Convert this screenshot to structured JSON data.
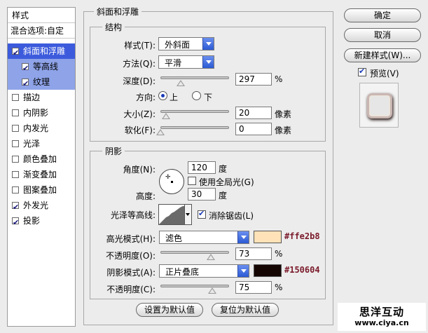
{
  "sidebar": {
    "title": "样式",
    "blending": "混合选项:自定",
    "items": [
      {
        "label": "斜面和浮雕",
        "checked": true
      },
      {
        "label": "等高线",
        "checked": true
      },
      {
        "label": "纹理",
        "checked": true
      },
      {
        "label": "描边",
        "checked": false
      },
      {
        "label": "内阴影",
        "checked": false
      },
      {
        "label": "内发光",
        "checked": false
      },
      {
        "label": "光泽",
        "checked": false
      },
      {
        "label": "颜色叠加",
        "checked": false
      },
      {
        "label": "渐变叠加",
        "checked": false
      },
      {
        "label": "图案叠加",
        "checked": false
      },
      {
        "label": "外发光",
        "checked": true
      },
      {
        "label": "投影",
        "checked": true
      }
    ]
  },
  "bevel": {
    "group_title": "斜面和浮雕",
    "structure": {
      "title": "结构",
      "style_label": "样式(T):",
      "style_value": "外斜面",
      "technique_label": "方法(Q):",
      "technique_value": "平滑",
      "depth_label": "深度(D):",
      "depth_value": "297",
      "depth_unit": "%",
      "depth_level": 0.3,
      "direction_label": "方向:",
      "direction_up": "上",
      "direction_down": "下",
      "direction_selected": "上",
      "size_label": "大小(Z):",
      "size_value": "20",
      "size_unit": "像素",
      "size_level": 0.08,
      "soften_label": "软化(F):",
      "soften_value": "0",
      "soften_unit": "像素",
      "soften_level": 0.0
    },
    "shading": {
      "title": "阴影",
      "angle_label": "角度(N):",
      "angle_value": "120",
      "angle_unit": "度",
      "global_light_label": "使用全局光(G)",
      "global_light": false,
      "altitude_label": "高度:",
      "altitude_value": "30",
      "altitude_unit": "度",
      "gloss_contour_label": "光泽等高线:",
      "antialias_label": "消除锯齿(L)",
      "antialias": true,
      "highlight_mode_label": "高光模式(H):",
      "highlight_mode_value": "滤色",
      "highlight_color": "#ffe2b8",
      "highlight_hex": "#ffe2b8",
      "highlight_opacity_label": "不透明度(O):",
      "highlight_opacity_value": "73",
      "highlight_opacity_unit": "%",
      "highlight_opacity_level": 0.73,
      "shadow_mode_label": "阴影模式(A):",
      "shadow_mode_value": "正片叠底",
      "shadow_color": "#150604",
      "shadow_hex": "#150604",
      "shadow_opacity_label": "不透明度(C):",
      "shadow_opacity_value": "75",
      "shadow_opacity_unit": "%",
      "shadow_opacity_level": 0.75
    },
    "make_default_label": "设置为默认值",
    "reset_default_label": "复位为默认值"
  },
  "actions": {
    "ok_label": "确定",
    "cancel_label": "取消",
    "new_style_label": "新建样式(W)...",
    "preview_label": "预览(V)",
    "preview_checked": true
  },
  "watermark": {
    "line1": "思洋互动",
    "line2": "www.ciya.cn"
  }
}
